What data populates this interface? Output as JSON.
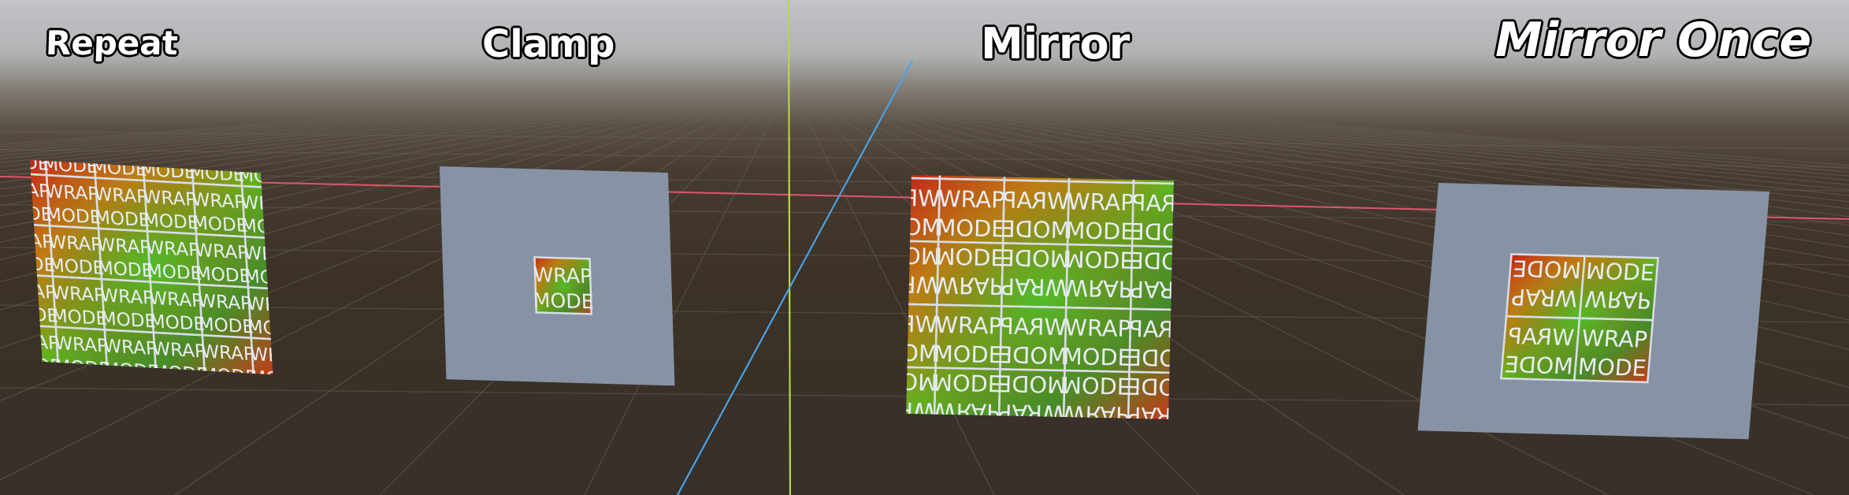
{
  "labels": {
    "repeat": "Repeat",
    "clamp": "Clamp",
    "mirror": "Mirror",
    "mirror_once": "Mirror Once"
  },
  "texture_words": {
    "top": "WRAP",
    "bottom": "MODE"
  },
  "colors": {
    "sky_top": "#c2c4c9",
    "ground": "#3b3127",
    "grid_line": "#6b6257",
    "x_axis": "#e0556b",
    "y_axis": "#b9d64a",
    "z_axis": "#4aa3e6",
    "border_color": "#8793a5",
    "label_fill": "#ffffff",
    "label_outline": "#000000"
  }
}
